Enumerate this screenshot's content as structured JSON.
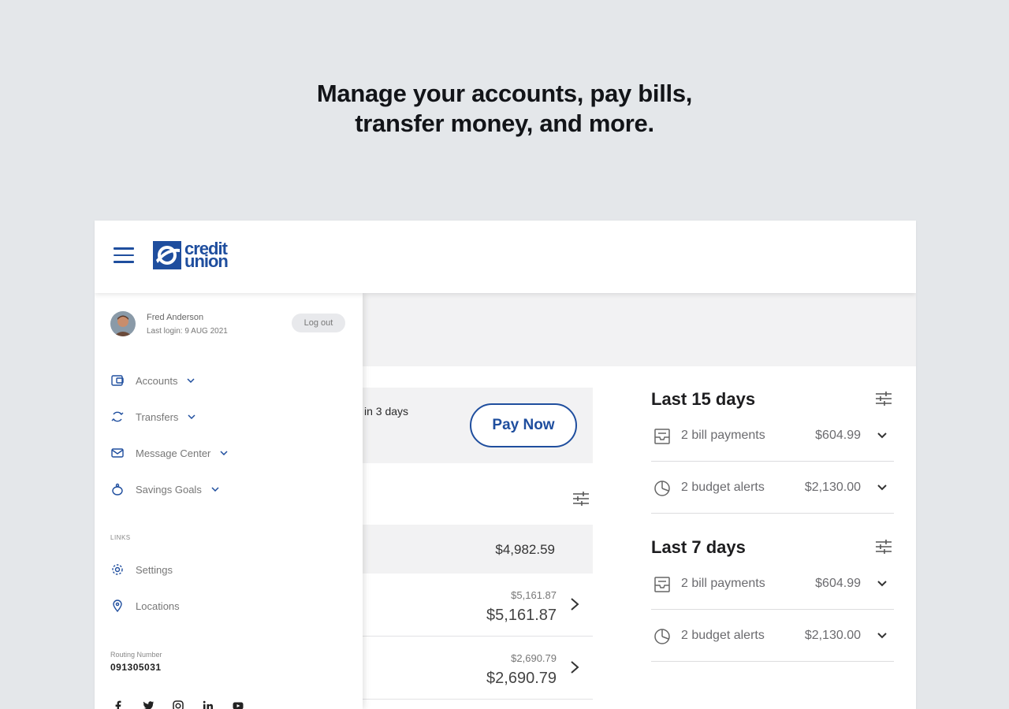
{
  "headline": {
    "line1": "Manage your accounts, pay bills,",
    "line2": "transfer money, and more."
  },
  "header": {
    "logo_line1": "credit",
    "logo_line2": "union"
  },
  "drawer": {
    "user_name": "Fred Anderson",
    "last_login": "Last login: 9 AUG 2021",
    "logout_label": "Log out",
    "nav": [
      {
        "label": "Accounts",
        "icon": "accounts-icon"
      },
      {
        "label": "Transfers",
        "icon": "transfers-icon"
      },
      {
        "label": "Message Center",
        "icon": "mail-icon"
      },
      {
        "label": "Savings Goals",
        "icon": "piggy-bank-icon"
      }
    ],
    "links_heading": "LINKS",
    "links": [
      {
        "label": "Settings",
        "icon": "gear-icon"
      },
      {
        "label": "Locations",
        "icon": "location-pin-icon"
      }
    ],
    "routing_label": "Routing Number",
    "routing_number": "091305031",
    "socials": [
      "facebook-icon",
      "twitter-icon",
      "instagram-icon",
      "linkedin-icon",
      "youtube-icon"
    ]
  },
  "main": {
    "due_text": "in 3 days",
    "pay_now_label": "Pay Now",
    "total": "$4,982.59",
    "accounts": [
      {
        "available": "$5,161.87",
        "balance": "$5,161.87"
      },
      {
        "available": "$2,690.79",
        "balance": "$2,690.79"
      }
    ]
  },
  "summary": {
    "periods": [
      {
        "title": "Last 15 days",
        "rows": [
          {
            "label": "2 bill payments",
            "value": "$604.99",
            "icon": "bill-icon"
          },
          {
            "label": "2 budget alerts",
            "value": "$2,130.00",
            "icon": "pie-chart-icon"
          }
        ]
      },
      {
        "title": "Last 7 days",
        "rows": [
          {
            "label": "2 bill payments",
            "value": "$604.99",
            "icon": "bill-icon"
          },
          {
            "label": "2 budget alerts",
            "value": "$2,130.00",
            "icon": "pie-chart-icon"
          }
        ]
      }
    ]
  },
  "colors": {
    "brand": "#1f4e9e",
    "background": "#e4e7ea",
    "panel": "#f2f2f3"
  }
}
